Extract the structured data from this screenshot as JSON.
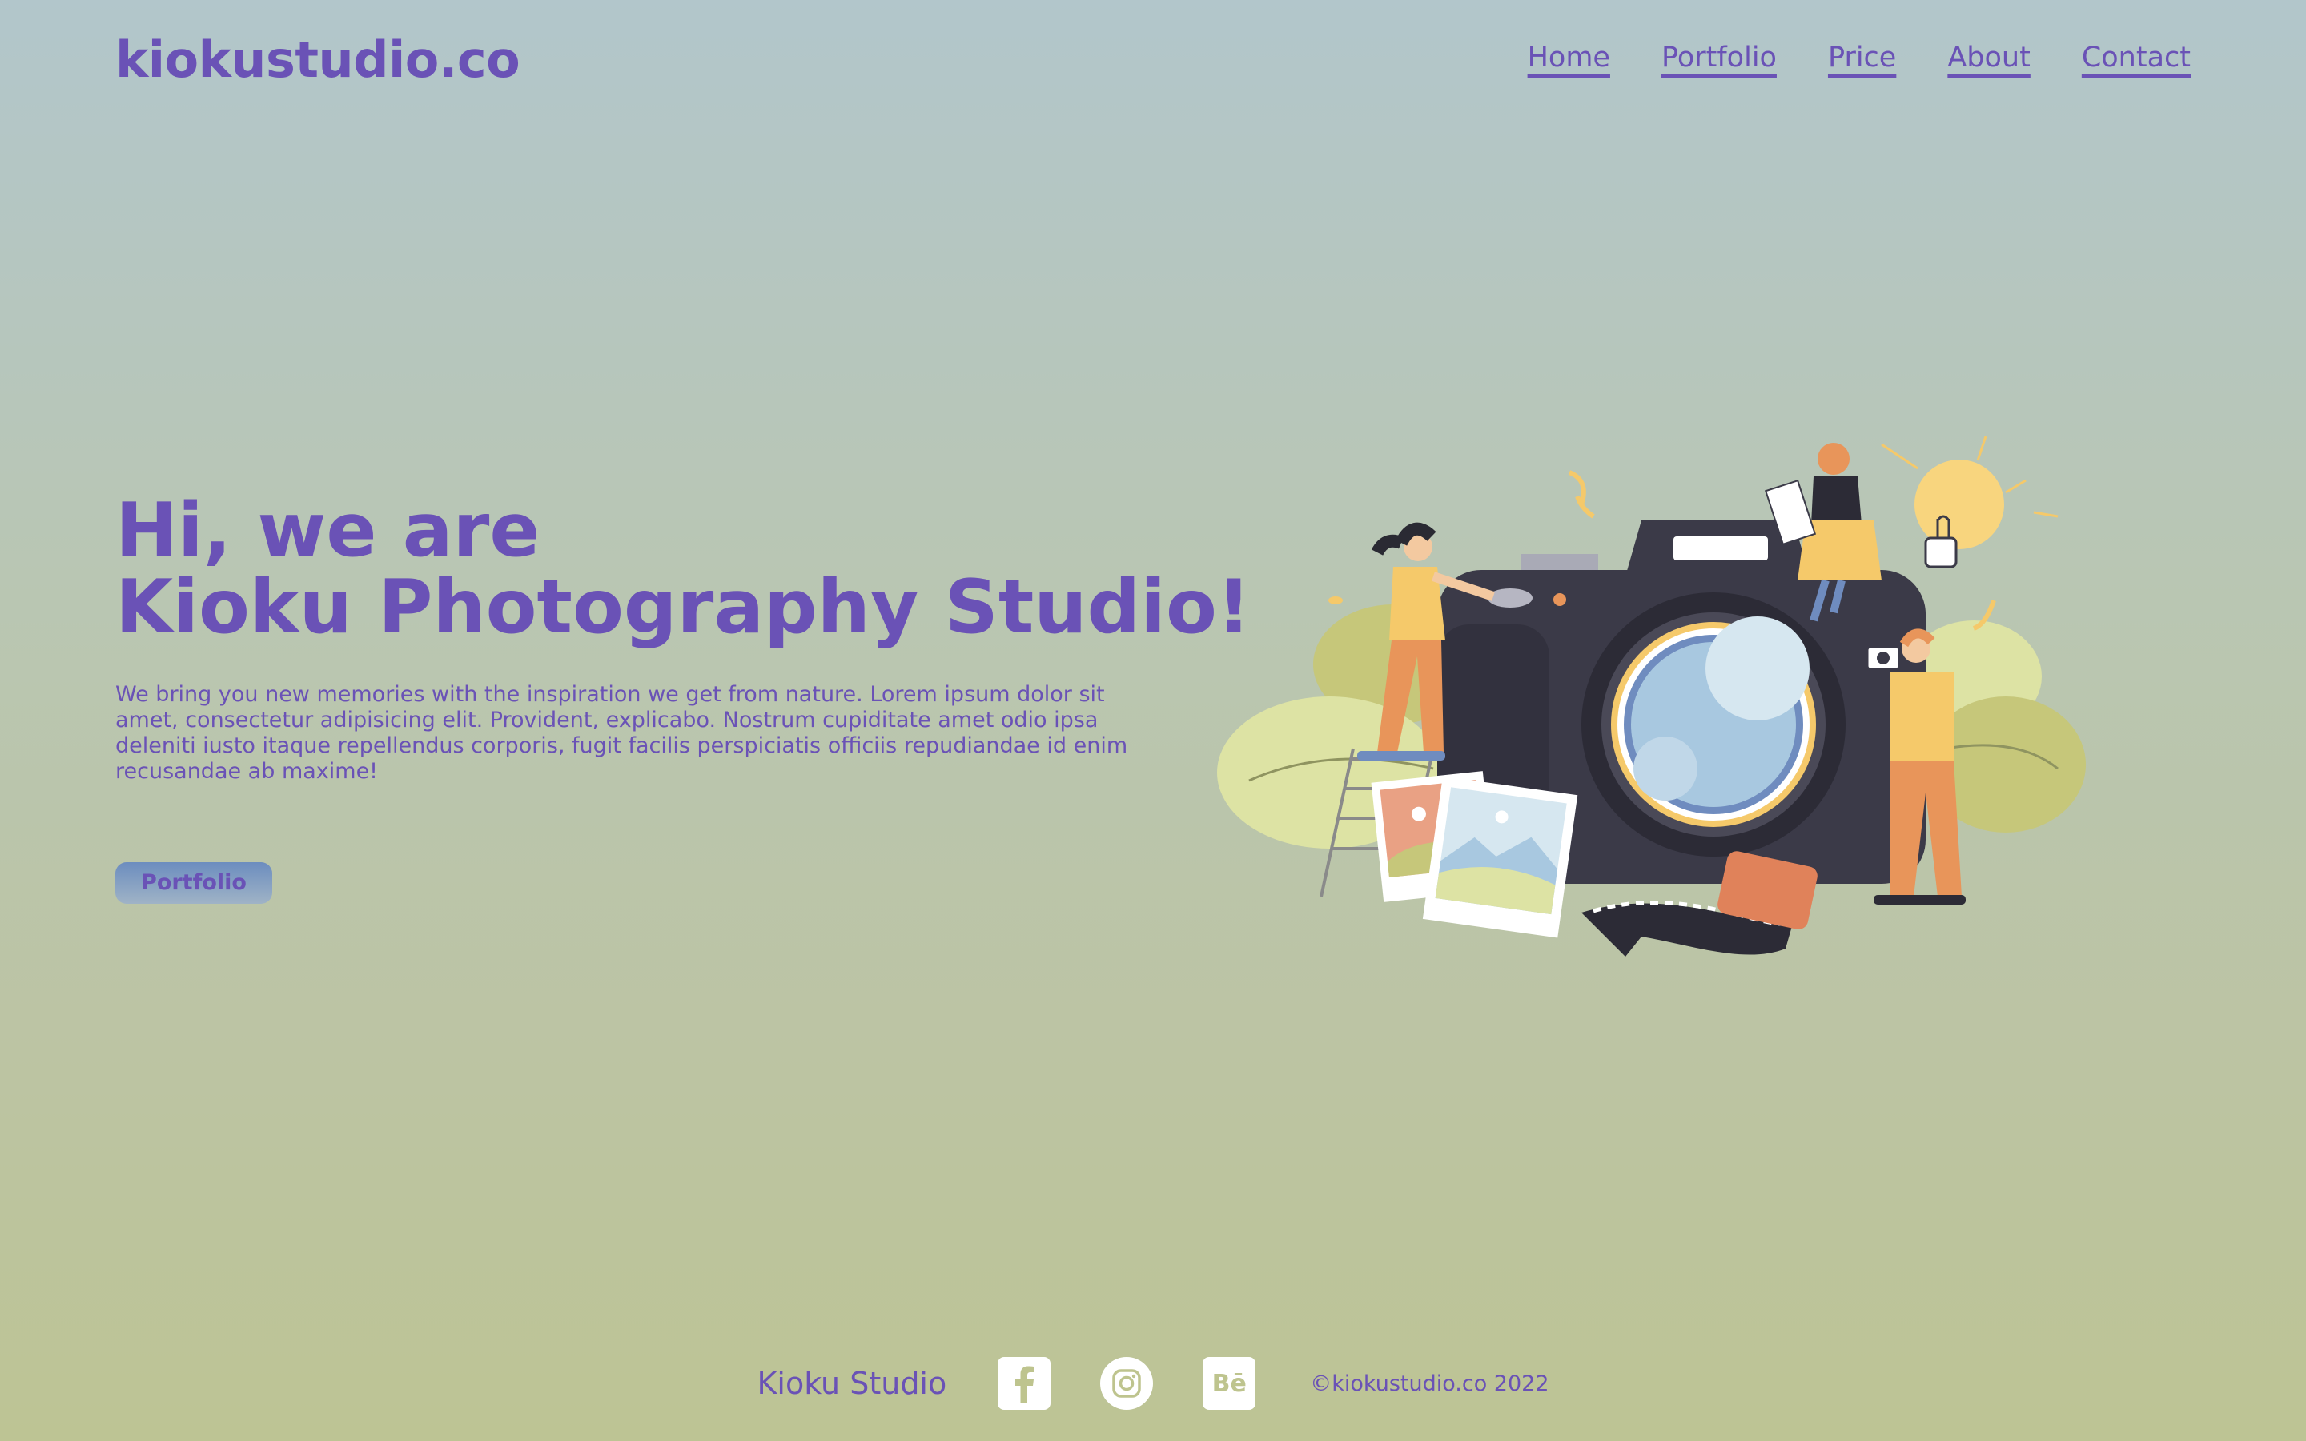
{
  "header": {
    "logo": "kiokustudio.co",
    "nav": [
      "Home",
      "Portfolio",
      "Price",
      "About",
      "Contact"
    ]
  },
  "hero": {
    "title_line1": "Hi, we are",
    "title_line2": "Kioku Photography Studio!",
    "description": "We bring you new memories with the inspiration we get from nature. Lorem ipsum dolor sit amet, consectetur adipisicing elit. Provident, explicabo. Nostrum cupiditate amet odio ipsa deleniti iusto itaque repellendus corporis, fugit facilis perspiciatis officiis repudiandae id enim recusandae ab maxime!",
    "button_label": "Portfolio"
  },
  "footer": {
    "brand": "Kioku Studio",
    "social": [
      "facebook-icon",
      "instagram-icon",
      "behance-icon"
    ],
    "behance_glyph": "Bē",
    "copyright": "©kiokustudio.co 2022"
  },
  "colors": {
    "accent": "#6a52b6",
    "camera": "#3b3a48",
    "lens": "#a8c8e0",
    "figure_top": "#f5c96a",
    "figure_pants": "#e8955a",
    "bush": "#dde3a4",
    "bush_dark": "#c6c77a"
  }
}
